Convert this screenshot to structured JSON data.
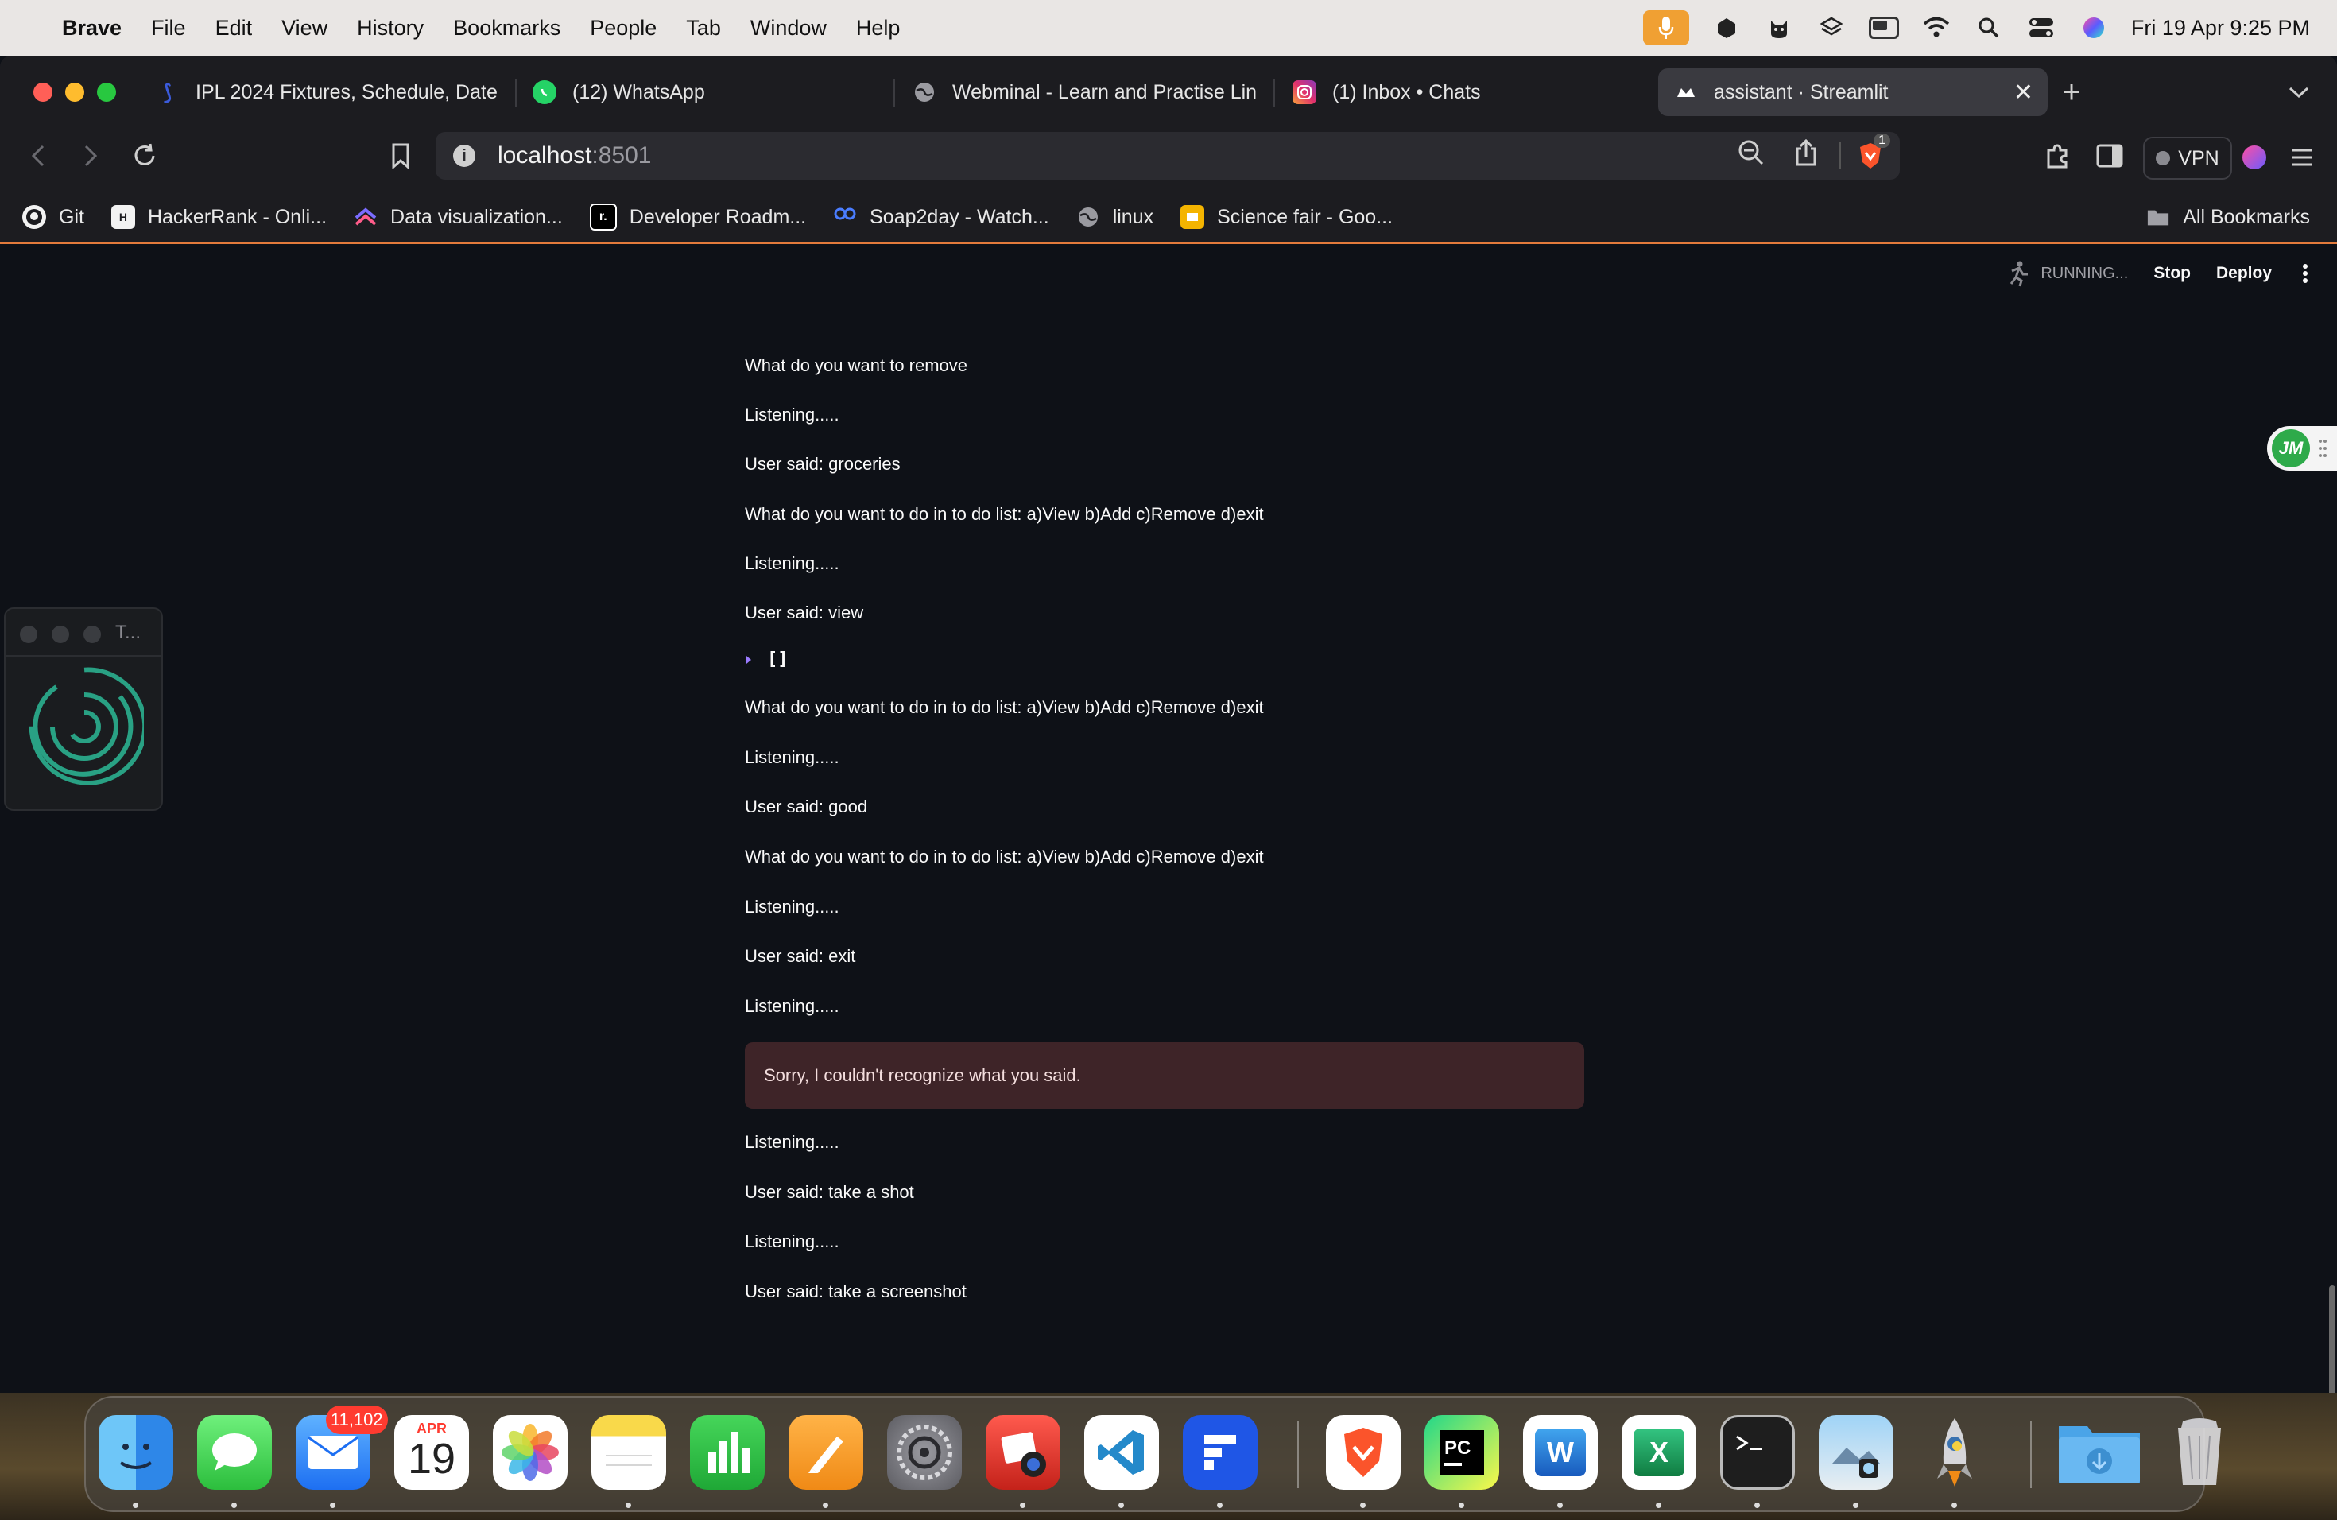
{
  "menubar": {
    "app_name": "Brave",
    "menus": [
      "File",
      "Edit",
      "View",
      "History",
      "Bookmarks",
      "People",
      "Tab",
      "Window",
      "Help"
    ],
    "datetime": "Fri 19 Apr  9:25 PM"
  },
  "tabs": [
    {
      "title": "IPL 2024 Fixtures, Schedule, Date",
      "icon": "ipl-icon"
    },
    {
      "title": "(12) WhatsApp",
      "icon": "whatsapp-icon"
    },
    {
      "title": "Webminal - Learn and Practise Lin",
      "icon": "globe-icon"
    },
    {
      "title": "(1) Inbox • Chats",
      "icon": "instagram-icon"
    },
    {
      "title": "assistant · Streamlit",
      "icon": "streamlit-icon",
      "active": true
    }
  ],
  "toolbar": {
    "url_host": "localhost",
    "url_port": ":8501",
    "shields_count": "1",
    "vpn_label": "VPN"
  },
  "bookmarks": {
    "items": [
      "Git",
      "HackerRank - Onli...",
      "Data visualization...",
      "Developer Roadm...",
      "Soap2day - Watch...",
      "linux",
      "Science fair - Goo..."
    ],
    "all_label": "All Bookmarks"
  },
  "streamlit": {
    "status": "RUNNING...",
    "stop": "Stop",
    "deploy": "Deploy"
  },
  "mini_window": {
    "title": "T..."
  },
  "side_widget": {
    "label": "JM"
  },
  "messages": [
    "What do you want to remove",
    "Listening.....",
    "User said: groceries",
    "What do you want to do in to do list: a)View b)Add c)Remove d)exit",
    "Listening.....",
    "User said: view",
    "[]",
    "What do you want to do in to do list: a)View b)Add c)Remove d)exit",
    "Listening.....",
    "User said: good",
    "What do you want to do in to do list: a)View b)Add c)Remove d)exit",
    "Listening.....",
    "User said: exit",
    "Listening.....",
    "Sorry, I couldn't recognize what you said.",
    "Listening.....",
    "User said: take a shot",
    "Listening.....",
    "User said: take a screenshot"
  ],
  "dock": {
    "mail_badge": "11,102",
    "calendar_month": "APR",
    "calendar_day": "19",
    "apps": [
      "Finder",
      "Messages",
      "Mail",
      "Calendar",
      "Photos",
      "Notes",
      "Numbers",
      "Pages",
      "System Settings",
      "Photo Booth",
      "Visual Studio Code",
      "Toolbox",
      "Brave Browser",
      "PyCharm",
      "Microsoft Word",
      "Microsoft Excel",
      "Terminal",
      "Preview",
      "Python Launcher",
      "Downloads",
      "Trash"
    ]
  },
  "colors": {
    "page_bg": "#0e1117",
    "error_bg": "#3e2428",
    "bookmark_accent": "#e37b3c",
    "running_green": "#2eaa4a"
  }
}
